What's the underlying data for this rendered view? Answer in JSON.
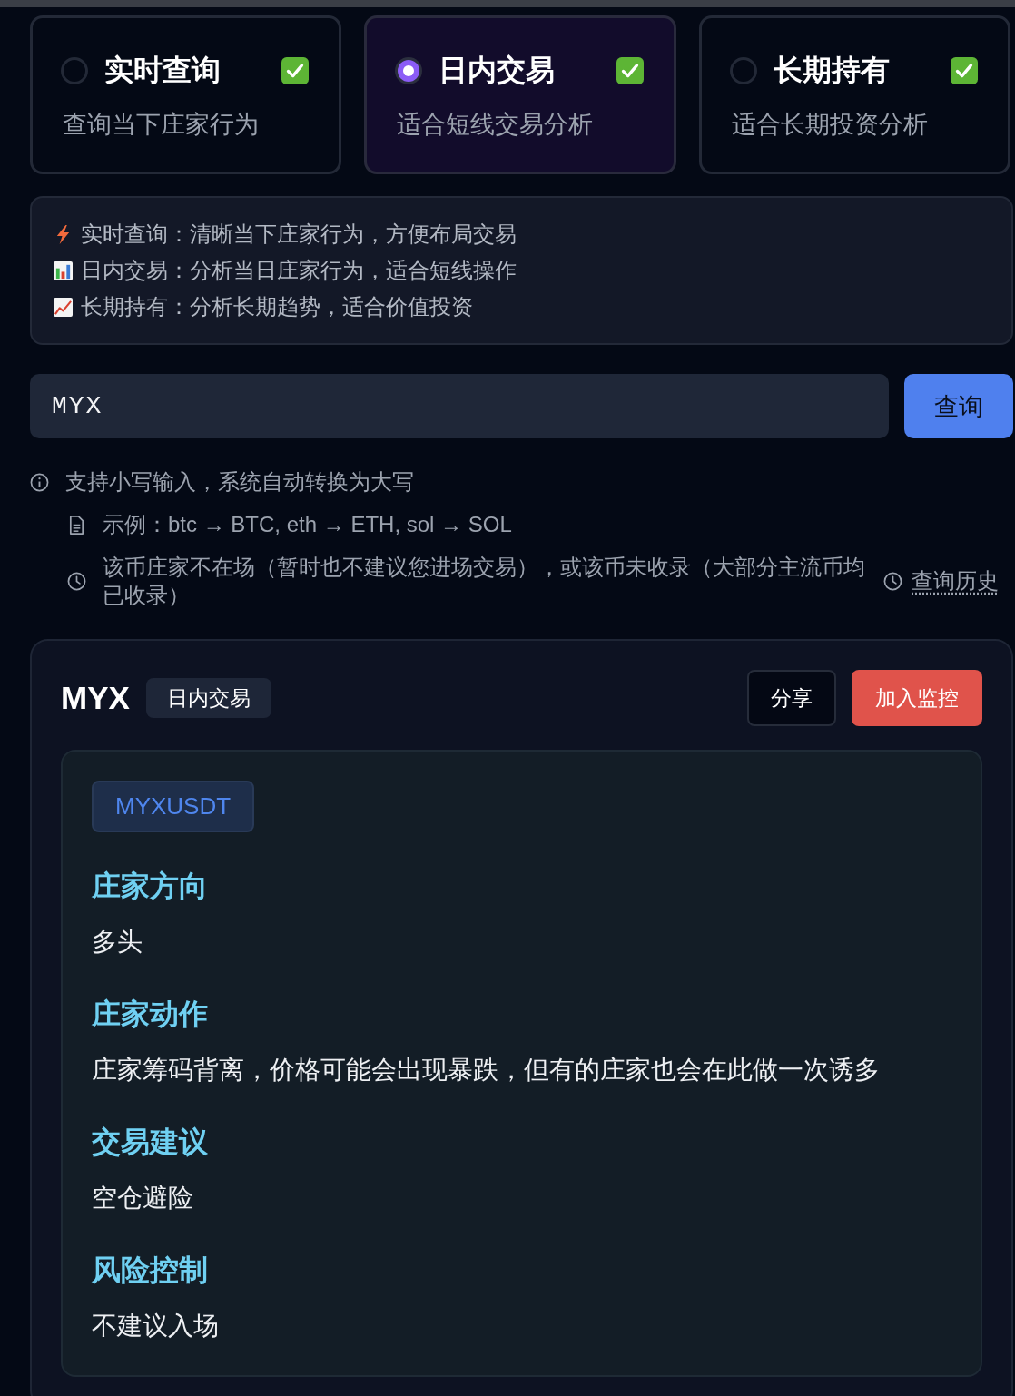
{
  "modes": [
    {
      "title": "实时查询",
      "description": "查询当下庄家行为",
      "selected": false
    },
    {
      "title": "日内交易",
      "description": "适合短线交易分析",
      "selected": true
    },
    {
      "title": "长期持有",
      "description": "适合长期投资分析",
      "selected": false
    }
  ],
  "info_lines": [
    "实时查询：清晰当下庄家行为，方便布局交易",
    "日内交易：分析当日庄家行为，适合短线操作",
    "长期持有：分析长期趋势，适合价值投资"
  ],
  "search": {
    "value": "MYX",
    "button": "查询"
  },
  "hints": [
    "支持小写输入，系统自动转换为大写",
    "示例：btc → BTC, eth → ETH, sol → SOL",
    "该币庄家不在场（暂时也不建议您进场交易），或该币未收录（大部分主流币均已收录）"
  ],
  "history_link": "查询历史",
  "result": {
    "symbol": "MYX",
    "mode_tag": "日内交易",
    "share_button": "分享",
    "watch_button": "加入监控",
    "pair": "MYXUSDT",
    "sections": [
      {
        "heading": "庄家方向",
        "body": "多头"
      },
      {
        "heading": "庄家动作",
        "body": "庄家筹码背离，价格可能会出现暴跌，但有的庄家也会在此做一次诱多"
      },
      {
        "heading": "交易建议",
        "body": "空仓避险"
      },
      {
        "heading": "风险控制",
        "body": "不建议入场"
      }
    ]
  }
}
